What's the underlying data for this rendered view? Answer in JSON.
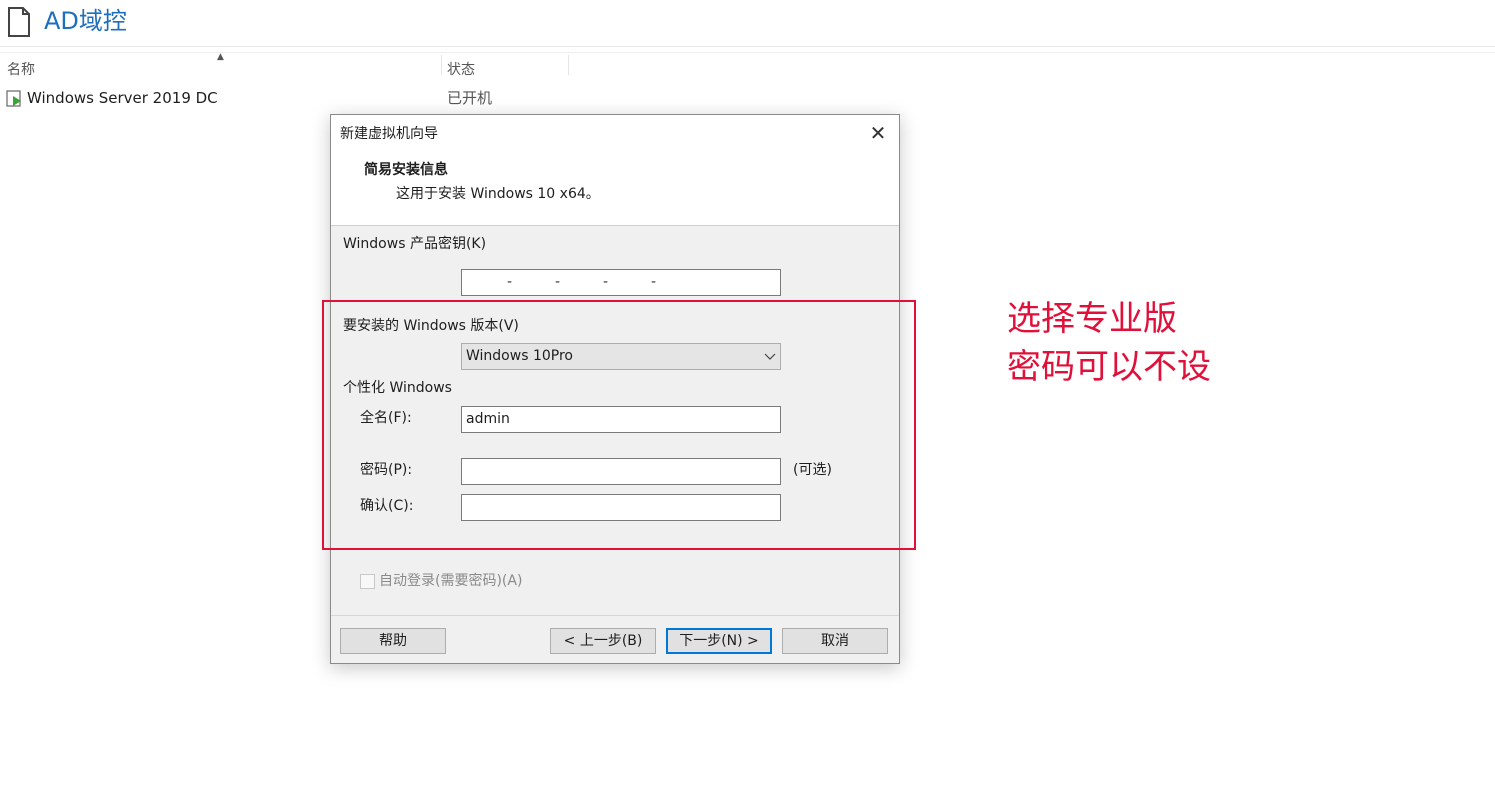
{
  "library": {
    "title": "AD域控",
    "columns": {
      "name": "名称",
      "status": "状态"
    },
    "vm": {
      "name": "Windows Server 2019 DC",
      "status": "已开机"
    }
  },
  "dialog": {
    "title": "新建虚拟机向导",
    "close_glyph": "✕",
    "heading": "简易安装信息",
    "subheading": "这用于安装 Windows 10 x64。",
    "product_key_label": "Windows 产品密钥(K)",
    "product_key_dashes": [
      "-",
      "-",
      "-",
      "-"
    ],
    "edition_label": "要安装的 Windows 版本(V)",
    "edition_value": "Windows 10Pro",
    "personalize_label": "个性化 Windows",
    "fullname_label": "全名(F):",
    "fullname_value": "admin",
    "password_label": "密码(P):",
    "password_value": "",
    "optional_label": "(可选)",
    "confirm_label": "确认(C):",
    "confirm_value": "",
    "autologin_label": "自动登录(需要密码)(A)",
    "buttons": {
      "help": "帮助",
      "back": "< 上一步(B)",
      "next": "下一步(N) >",
      "cancel": "取消"
    }
  },
  "annotation": {
    "line1": "选择专业版",
    "line2": "密码可以不设",
    "color": "#e0103a"
  },
  "colors": {
    "title_blue": "#1f6fbf",
    "dialog_bg": "#f0f0f0",
    "default_button_border": "#0078d7"
  }
}
